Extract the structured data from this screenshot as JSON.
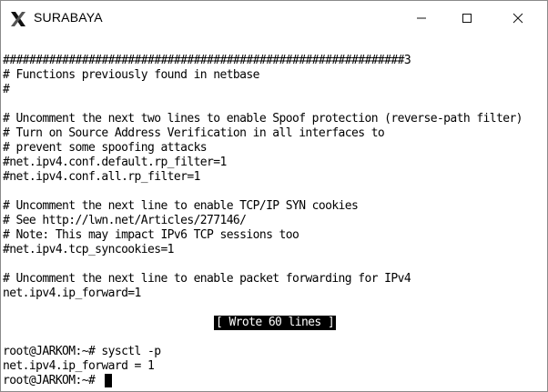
{
  "window": {
    "title": "SURABAYA",
    "controls": {
      "minimize_icon": "minimize-icon",
      "maximize_icon": "maximize-icon",
      "close_icon": "close-icon"
    }
  },
  "terminal": {
    "lines": [
      "#############################################################3",
      "# Functions previously found in netbase",
      "#",
      "",
      "# Uncomment the next two lines to enable Spoof protection (reverse-path filter)",
      "# Turn on Source Address Verification in all interfaces to",
      "# prevent some spoofing attacks",
      "#net.ipv4.conf.default.rp_filter=1",
      "#net.ipv4.conf.all.rp_filter=1",
      "",
      "# Uncomment the next line to enable TCP/IP SYN cookies",
      "# See http://lwn.net/Articles/277146/",
      "# Note: This may impact IPv6 TCP sessions too",
      "#net.ipv4.tcp_syncookies=1",
      "",
      "# Uncomment the next line to enable packet forwarding for IPv4",
      "net.ipv4.ip_forward=1",
      "",
      "",
      "",
      "root@JARKOM:~# sysctl -p",
      "net.ipv4.ip_forward = 1",
      "root@JARKOM:~# "
    ],
    "status_message": "[ Wrote 60 lines ]"
  }
}
